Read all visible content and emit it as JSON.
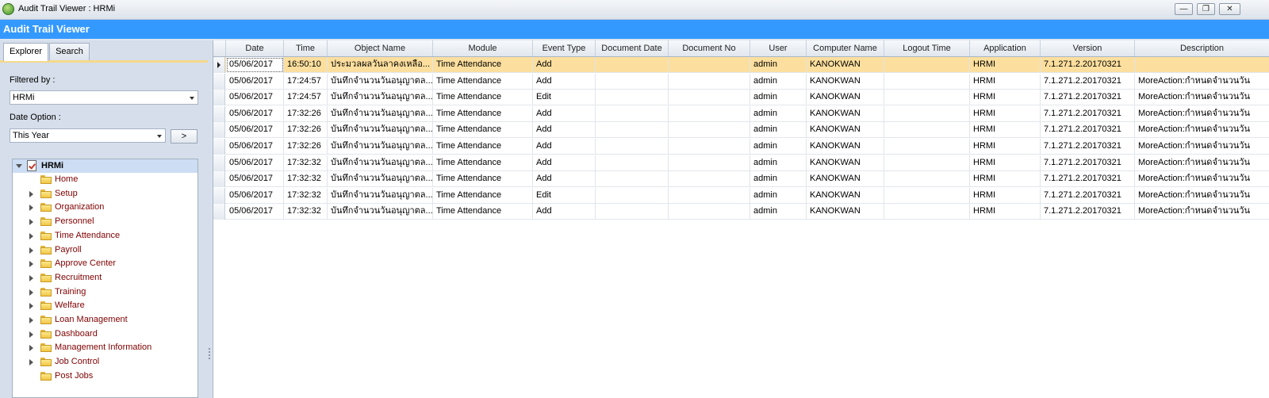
{
  "window": {
    "title": "Audit Trail Viewer : HRMi",
    "minimize": "—",
    "restore": "❐",
    "close": "✕"
  },
  "header": {
    "title": "Audit Trail Viewer"
  },
  "left": {
    "tabs": [
      "Explorer",
      "Search"
    ],
    "filtered_by_label": "Filtered by :",
    "filtered_by_value": "HRMi",
    "date_option_label": "Date Option :",
    "date_option_value": "This Year",
    "go_label": ">",
    "tree": {
      "root": "HRMi",
      "items": [
        {
          "label": "Home",
          "expandable": false
        },
        {
          "label": "Setup",
          "expandable": true
        },
        {
          "label": "Organization",
          "expandable": true
        },
        {
          "label": "Personnel",
          "expandable": true
        },
        {
          "label": "Time Attendance",
          "expandable": true
        },
        {
          "label": "Payroll",
          "expandable": true
        },
        {
          "label": "Approve Center",
          "expandable": true
        },
        {
          "label": "Recruitment",
          "expandable": true
        },
        {
          "label": "Training",
          "expandable": true
        },
        {
          "label": "Welfare",
          "expandable": true
        },
        {
          "label": "Loan Management",
          "expandable": true
        },
        {
          "label": "Dashboard",
          "expandable": true
        },
        {
          "label": "Management Information",
          "expandable": true
        },
        {
          "label": "Job Control",
          "expandable": true
        },
        {
          "label": "Post Jobs",
          "expandable": false
        }
      ]
    }
  },
  "grid": {
    "columns": [
      "Date",
      "Time",
      "Object Name",
      "Module",
      "Event Type",
      "Document Date",
      "Document No",
      "User",
      "Computer Name",
      "Logout Time",
      "Application",
      "Version",
      "Description"
    ],
    "rows": [
      [
        "05/06/2017",
        "16:50:10",
        "ประมวลผลวันลาคงเหลือ...",
        "Time Attendance",
        "Add",
        "",
        "",
        "admin",
        "KANOKWAN",
        "",
        "HRMI",
        "7.1.271.2.20170321",
        ""
      ],
      [
        "05/06/2017",
        "17:24:57",
        "บันทึกจำนวนวันอนุญาตล...",
        "Time Attendance",
        "Add",
        "",
        "",
        "admin",
        "KANOKWAN",
        "",
        "HRMI",
        "7.1.271.2.20170321",
        "MoreAction:กำหนดจำนวนวัน"
      ],
      [
        "05/06/2017",
        "17:24:57",
        "บันทึกจำนวนวันอนุญาตล...",
        "Time Attendance",
        "Edit",
        "",
        "",
        "admin",
        "KANOKWAN",
        "",
        "HRMI",
        "7.1.271.2.20170321",
        "MoreAction:กำหนดจำนวนวัน"
      ],
      [
        "05/06/2017",
        "17:32:26",
        "บันทึกจำนวนวันอนุญาตล...",
        "Time Attendance",
        "Add",
        "",
        "",
        "admin",
        "KANOKWAN",
        "",
        "HRMI",
        "7.1.271.2.20170321",
        "MoreAction:กำหนดจำนวนวัน"
      ],
      [
        "05/06/2017",
        "17:32:26",
        "บันทึกจำนวนวันอนุญาตล...",
        "Time Attendance",
        "Add",
        "",
        "",
        "admin",
        "KANOKWAN",
        "",
        "HRMI",
        "7.1.271.2.20170321",
        "MoreAction:กำหนดจำนวนวัน"
      ],
      [
        "05/06/2017",
        "17:32:26",
        "บันทึกจำนวนวันอนุญาตล...",
        "Time Attendance",
        "Add",
        "",
        "",
        "admin",
        "KANOKWAN",
        "",
        "HRMI",
        "7.1.271.2.20170321",
        "MoreAction:กำหนดจำนวนวัน"
      ],
      [
        "05/06/2017",
        "17:32:32",
        "บันทึกจำนวนวันอนุญาตล...",
        "Time Attendance",
        "Add",
        "",
        "",
        "admin",
        "KANOKWAN",
        "",
        "HRMI",
        "7.1.271.2.20170321",
        "MoreAction:กำหนดจำนวนวัน"
      ],
      [
        "05/06/2017",
        "17:32:32",
        "บันทึกจำนวนวันอนุญาตล...",
        "Time Attendance",
        "Add",
        "",
        "",
        "admin",
        "KANOKWAN",
        "",
        "HRMI",
        "7.1.271.2.20170321",
        "MoreAction:กำหนดจำนวนวัน"
      ],
      [
        "05/06/2017",
        "17:32:32",
        "บันทึกจำนวนวันอนุญาตล...",
        "Time Attendance",
        "Edit",
        "",
        "",
        "admin",
        "KANOKWAN",
        "",
        "HRMI",
        "7.1.271.2.20170321",
        "MoreAction:กำหนดจำนวนวัน"
      ],
      [
        "05/06/2017",
        "17:32:32",
        "บันทึกจำนวนวันอนุญาตล...",
        "Time Attendance",
        "Add",
        "",
        "",
        "admin",
        "KANOKWAN",
        "",
        "HRMI",
        "7.1.271.2.20170321",
        "MoreAction:กำหนดจำนวนวัน"
      ]
    ],
    "selected_row": 0
  },
  "colors": {
    "header_bg": "#3399ff",
    "selected_row": "#fcdf9e",
    "tree_label": "#800000",
    "tab_accent": "#f6d88b"
  }
}
